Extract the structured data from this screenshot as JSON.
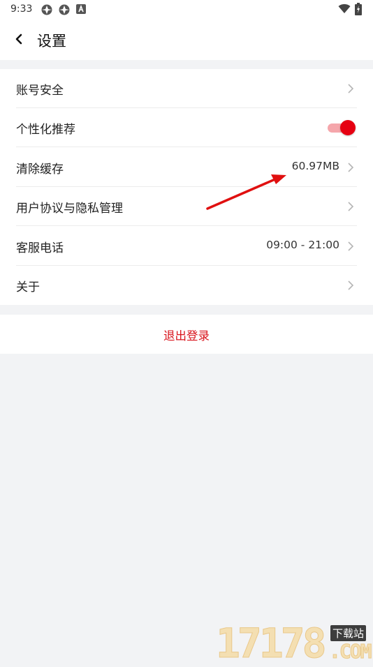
{
  "status_bar": {
    "time": "9:33"
  },
  "header": {
    "title": "设置"
  },
  "settings": {
    "items": [
      {
        "label": "账号安全",
        "value": "",
        "has_chevron": true
      },
      {
        "label": "个性化推荐",
        "value": "",
        "toggle_on": true
      },
      {
        "label": "清除缓存",
        "value": "60.97MB",
        "has_chevron": true
      },
      {
        "label": "用户协议与隐私管理",
        "value": "",
        "has_chevron": true
      },
      {
        "label": "客服电话",
        "value": "09:00 - 21:00",
        "has_chevron": true
      },
      {
        "label": "关于",
        "value": "",
        "has_chevron": true
      }
    ]
  },
  "logout": {
    "label": "退出登录"
  },
  "watermark": {
    "digits": "17178",
    "sub": "下载站",
    "com": ".COM"
  },
  "colors": {
    "accent_red": "#e60012",
    "logout_red": "#d9141c",
    "page_bg": "#f2f3f5",
    "annotation_arrow": "#e01010"
  },
  "icons": {
    "back": "chevron-left-icon",
    "row_chevron": "chevron-right-icon",
    "wifi": "wifi-icon",
    "battery": "battery-icon"
  }
}
